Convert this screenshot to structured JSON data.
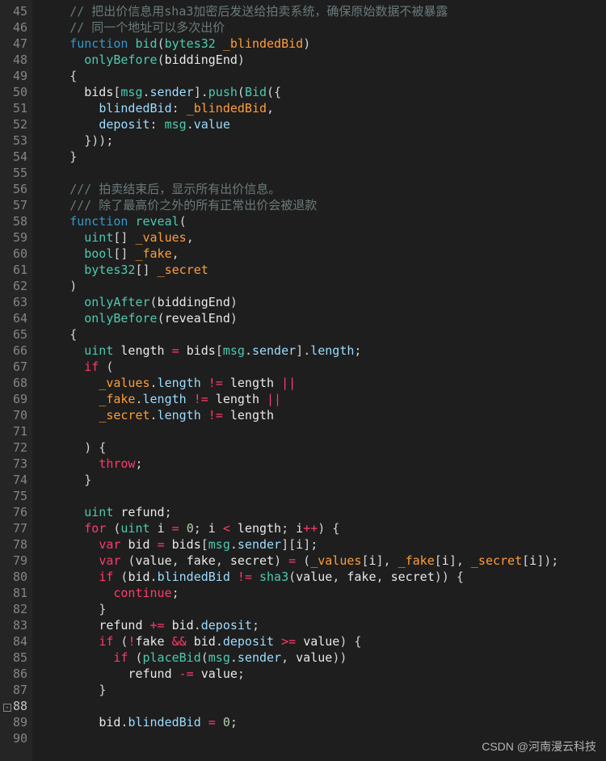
{
  "startLine": 45,
  "endLine": 90,
  "cursorLine": 88,
  "watermark": "CSDN @河南漫云科技",
  "lines": [
    {
      "n": 45,
      "tokens": [
        [
          "    ",
          ""
        ],
        [
          "// 把出价信息用sha3加密后发送给拍卖系统，确保原始数据不被暴露",
          "c-comment"
        ]
      ]
    },
    {
      "n": 46,
      "tokens": [
        [
          "    ",
          ""
        ],
        [
          "// 同一个地址可以多次出价",
          "c-comment"
        ]
      ]
    },
    {
      "n": 47,
      "tokens": [
        [
          "    ",
          ""
        ],
        [
          "function",
          "c-keyword"
        ],
        [
          " ",
          ""
        ],
        [
          "bid",
          "c-funcname"
        ],
        [
          "(",
          "c-punc"
        ],
        [
          "bytes32",
          "c-type"
        ],
        [
          " ",
          ""
        ],
        [
          "_blindedBid",
          "c-param"
        ],
        [
          ")",
          "c-punc"
        ]
      ]
    },
    {
      "n": 48,
      "tokens": [
        [
          "      ",
          ""
        ],
        [
          "onlyBefore",
          "c-funcname"
        ],
        [
          "(",
          "c-punc"
        ],
        [
          "biddingEnd",
          "c-var"
        ],
        [
          ")",
          "c-punc"
        ]
      ]
    },
    {
      "n": 49,
      "tokens": [
        [
          "    ",
          ""
        ],
        [
          "{",
          "c-punc"
        ]
      ]
    },
    {
      "n": 50,
      "tokens": [
        [
          "      ",
          ""
        ],
        [
          "bids",
          "c-var"
        ],
        [
          "[",
          "c-punc"
        ],
        [
          "msg",
          "c-msg"
        ],
        [
          ".",
          "c-punc"
        ],
        [
          "sender",
          "c-prop"
        ],
        [
          "]",
          "c-punc"
        ],
        [
          ".",
          "c-punc"
        ],
        [
          "push",
          "c-funcname"
        ],
        [
          "(",
          "c-punc"
        ],
        [
          "Bid",
          "c-type"
        ],
        [
          "({",
          "c-punc"
        ]
      ]
    },
    {
      "n": 51,
      "tokens": [
        [
          "        ",
          ""
        ],
        [
          "blindedBid",
          "c-prop"
        ],
        [
          ": ",
          "c-punc"
        ],
        [
          "_blindedBid",
          "c-param"
        ],
        [
          ",",
          "c-punc"
        ]
      ]
    },
    {
      "n": 52,
      "tokens": [
        [
          "        ",
          ""
        ],
        [
          "deposit",
          "c-prop"
        ],
        [
          ": ",
          "c-punc"
        ],
        [
          "msg",
          "c-msg"
        ],
        [
          ".",
          "c-punc"
        ],
        [
          "value",
          "c-prop"
        ]
      ]
    },
    {
      "n": 53,
      "tokens": [
        [
          "      ",
          ""
        ],
        [
          "}));",
          "c-punc"
        ]
      ]
    },
    {
      "n": 54,
      "tokens": [
        [
          "    ",
          ""
        ],
        [
          "}",
          "c-punc"
        ]
      ]
    },
    {
      "n": 55,
      "tokens": [
        [
          "",
          ""
        ]
      ]
    },
    {
      "n": 56,
      "tokens": [
        [
          "    ",
          ""
        ],
        [
          "/// 拍卖结束后，显示所有出价信息。",
          "c-comment"
        ]
      ]
    },
    {
      "n": 57,
      "tokens": [
        [
          "    ",
          ""
        ],
        [
          "/// 除了最高价之外的所有正常出价会被退款",
          "c-comment"
        ]
      ]
    },
    {
      "n": 58,
      "tokens": [
        [
          "    ",
          ""
        ],
        [
          "function",
          "c-keyword"
        ],
        [
          " ",
          ""
        ],
        [
          "reveal",
          "c-funcname"
        ],
        [
          "(",
          "c-punc"
        ]
      ]
    },
    {
      "n": 59,
      "tokens": [
        [
          "      ",
          ""
        ],
        [
          "uint",
          "c-type"
        ],
        [
          "[]",
          "c-punc"
        ],
        [
          " ",
          ""
        ],
        [
          "_values",
          "c-param"
        ],
        [
          ",",
          "c-punc"
        ]
      ]
    },
    {
      "n": 60,
      "tokens": [
        [
          "      ",
          ""
        ],
        [
          "bool",
          "c-type"
        ],
        [
          "[]",
          "c-punc"
        ],
        [
          " ",
          ""
        ],
        [
          "_fake",
          "c-param"
        ],
        [
          ",",
          "c-punc"
        ]
      ]
    },
    {
      "n": 61,
      "tokens": [
        [
          "      ",
          ""
        ],
        [
          "bytes32",
          "c-type"
        ],
        [
          "[]",
          "c-punc"
        ],
        [
          " ",
          ""
        ],
        [
          "_secret",
          "c-param"
        ]
      ]
    },
    {
      "n": 62,
      "tokens": [
        [
          "    ",
          ""
        ],
        [
          ")",
          "c-punc"
        ]
      ]
    },
    {
      "n": 63,
      "tokens": [
        [
          "      ",
          ""
        ],
        [
          "onlyAfter",
          "c-funcname"
        ],
        [
          "(",
          "c-punc"
        ],
        [
          "biddingEnd",
          "c-var"
        ],
        [
          ")",
          "c-punc"
        ]
      ]
    },
    {
      "n": 64,
      "tokens": [
        [
          "      ",
          ""
        ],
        [
          "onlyBefore",
          "c-funcname"
        ],
        [
          "(",
          "c-punc"
        ],
        [
          "revealEnd",
          "c-var"
        ],
        [
          ")",
          "c-punc"
        ]
      ]
    },
    {
      "n": 65,
      "tokens": [
        [
          "    ",
          ""
        ],
        [
          "{",
          "c-punc"
        ]
      ]
    },
    {
      "n": 66,
      "tokens": [
        [
          "      ",
          ""
        ],
        [
          "uint",
          "c-type"
        ],
        [
          " ",
          ""
        ],
        [
          "length",
          "c-var"
        ],
        [
          " ",
          ""
        ],
        [
          "=",
          "c-op"
        ],
        [
          " ",
          ""
        ],
        [
          "bids",
          "c-var"
        ],
        [
          "[",
          "c-punc"
        ],
        [
          "msg",
          "c-msg"
        ],
        [
          ".",
          "c-punc"
        ],
        [
          "sender",
          "c-prop"
        ],
        [
          "]",
          "c-punc"
        ],
        [
          ".",
          "c-punc"
        ],
        [
          "length",
          "c-prop"
        ],
        [
          ";",
          "c-punc"
        ]
      ]
    },
    {
      "n": 67,
      "tokens": [
        [
          "      ",
          ""
        ],
        [
          "if",
          "c-control"
        ],
        [
          " (",
          "c-punc"
        ]
      ]
    },
    {
      "n": 68,
      "tokens": [
        [
          "        ",
          ""
        ],
        [
          "_values",
          "c-param"
        ],
        [
          ".",
          "c-punc"
        ],
        [
          "length",
          "c-prop"
        ],
        [
          " ",
          ""
        ],
        [
          "!=",
          "c-op"
        ],
        [
          " ",
          ""
        ],
        [
          "length",
          "c-var"
        ],
        [
          " ",
          ""
        ],
        [
          "||",
          "c-op"
        ]
      ]
    },
    {
      "n": 69,
      "tokens": [
        [
          "        ",
          ""
        ],
        [
          "_fake",
          "c-param"
        ],
        [
          ".",
          "c-punc"
        ],
        [
          "length",
          "c-prop"
        ],
        [
          " ",
          ""
        ],
        [
          "!=",
          "c-op"
        ],
        [
          " ",
          ""
        ],
        [
          "length",
          "c-var"
        ],
        [
          " ",
          ""
        ],
        [
          "||",
          "c-op"
        ]
      ]
    },
    {
      "n": 70,
      "tokens": [
        [
          "        ",
          ""
        ],
        [
          "_secret",
          "c-param"
        ],
        [
          ".",
          "c-punc"
        ],
        [
          "length",
          "c-prop"
        ],
        [
          " ",
          ""
        ],
        [
          "!=",
          "c-op"
        ],
        [
          " ",
          ""
        ],
        [
          "length",
          "c-var"
        ]
      ]
    },
    {
      "n": 71,
      "tokens": [
        [
          "",
          ""
        ]
      ]
    },
    {
      "n": 72,
      "tokens": [
        [
          "      ",
          ""
        ],
        [
          ") {",
          "c-punc"
        ]
      ]
    },
    {
      "n": 73,
      "tokens": [
        [
          "        ",
          ""
        ],
        [
          "throw",
          "c-control"
        ],
        [
          ";",
          "c-punc"
        ]
      ]
    },
    {
      "n": 74,
      "tokens": [
        [
          "      ",
          ""
        ],
        [
          "}",
          "c-punc"
        ]
      ]
    },
    {
      "n": 75,
      "tokens": [
        [
          "",
          ""
        ]
      ]
    },
    {
      "n": 76,
      "tokens": [
        [
          "      ",
          ""
        ],
        [
          "uint",
          "c-type"
        ],
        [
          " ",
          ""
        ],
        [
          "refund",
          "c-var"
        ],
        [
          ";",
          "c-punc"
        ]
      ]
    },
    {
      "n": 77,
      "tokens": [
        [
          "      ",
          ""
        ],
        [
          "for",
          "c-control"
        ],
        [
          " (",
          "c-punc"
        ],
        [
          "uint",
          "c-type"
        ],
        [
          " ",
          ""
        ],
        [
          "i",
          "c-var"
        ],
        [
          " ",
          ""
        ],
        [
          "=",
          "c-op"
        ],
        [
          " ",
          ""
        ],
        [
          "0",
          "c-num"
        ],
        [
          "; ",
          "c-punc"
        ],
        [
          "i",
          "c-var"
        ],
        [
          " ",
          ""
        ],
        [
          "<",
          "c-op"
        ],
        [
          " ",
          ""
        ],
        [
          "length",
          "c-var"
        ],
        [
          "; ",
          "c-punc"
        ],
        [
          "i",
          "c-var"
        ],
        [
          "++",
          "c-op"
        ],
        [
          ") {",
          "c-punc"
        ]
      ]
    },
    {
      "n": 78,
      "tokens": [
        [
          "        ",
          ""
        ],
        [
          "var",
          "c-control"
        ],
        [
          " ",
          ""
        ],
        [
          "bid",
          "c-var"
        ],
        [
          " ",
          ""
        ],
        [
          "=",
          "c-op"
        ],
        [
          " ",
          ""
        ],
        [
          "bids",
          "c-var"
        ],
        [
          "[",
          "c-punc"
        ],
        [
          "msg",
          "c-msg"
        ],
        [
          ".",
          "c-punc"
        ],
        [
          "sender",
          "c-prop"
        ],
        [
          "][",
          "c-punc"
        ],
        [
          "i",
          "c-var"
        ],
        [
          "];",
          "c-punc"
        ]
      ]
    },
    {
      "n": 79,
      "tokens": [
        [
          "        ",
          ""
        ],
        [
          "var",
          "c-control"
        ],
        [
          " (",
          "c-punc"
        ],
        [
          "value",
          "c-var"
        ],
        [
          ", ",
          "c-punc"
        ],
        [
          "fake",
          "c-var"
        ],
        [
          ", ",
          "c-punc"
        ],
        [
          "secret",
          "c-var"
        ],
        [
          ") ",
          "c-punc"
        ],
        [
          "=",
          "c-op"
        ],
        [
          " (",
          "c-punc"
        ],
        [
          "_values",
          "c-param"
        ],
        [
          "[",
          "c-punc"
        ],
        [
          "i",
          "c-var"
        ],
        [
          "], ",
          "c-punc"
        ],
        [
          "_fake",
          "c-param"
        ],
        [
          "[",
          "c-punc"
        ],
        [
          "i",
          "c-var"
        ],
        [
          "], ",
          "c-punc"
        ],
        [
          "_secret",
          "c-param"
        ],
        [
          "[",
          "c-punc"
        ],
        [
          "i",
          "c-var"
        ],
        [
          "]);",
          "c-punc"
        ]
      ]
    },
    {
      "n": 80,
      "tokens": [
        [
          "        ",
          ""
        ],
        [
          "if",
          "c-control"
        ],
        [
          " (",
          "c-punc"
        ],
        [
          "bid",
          "c-var"
        ],
        [
          ".",
          "c-punc"
        ],
        [
          "blindedBid",
          "c-prop"
        ],
        [
          " ",
          ""
        ],
        [
          "!=",
          "c-op"
        ],
        [
          " ",
          ""
        ],
        [
          "sha3",
          "c-funcname"
        ],
        [
          "(",
          "c-punc"
        ],
        [
          "value",
          "c-var"
        ],
        [
          ", ",
          "c-punc"
        ],
        [
          "fake",
          "c-var"
        ],
        [
          ", ",
          "c-punc"
        ],
        [
          "secret",
          "c-var"
        ],
        [
          ")) {",
          "c-punc"
        ]
      ]
    },
    {
      "n": 81,
      "tokens": [
        [
          "          ",
          ""
        ],
        [
          "continue",
          "c-control"
        ],
        [
          ";",
          "c-punc"
        ]
      ]
    },
    {
      "n": 82,
      "tokens": [
        [
          "        ",
          ""
        ],
        [
          "}",
          "c-punc"
        ]
      ]
    },
    {
      "n": 83,
      "tokens": [
        [
          "        ",
          ""
        ],
        [
          "refund",
          "c-var"
        ],
        [
          " ",
          ""
        ],
        [
          "+=",
          "c-op"
        ],
        [
          " ",
          ""
        ],
        [
          "bid",
          "c-var"
        ],
        [
          ".",
          "c-punc"
        ],
        [
          "deposit",
          "c-prop"
        ],
        [
          ";",
          "c-punc"
        ]
      ]
    },
    {
      "n": 84,
      "tokens": [
        [
          "        ",
          ""
        ],
        [
          "if",
          "c-control"
        ],
        [
          " (",
          "c-punc"
        ],
        [
          "!",
          "c-op"
        ],
        [
          "fake",
          "c-var"
        ],
        [
          " ",
          ""
        ],
        [
          "&&",
          "c-op"
        ],
        [
          " ",
          ""
        ],
        [
          "bid",
          "c-var"
        ],
        [
          ".",
          "c-punc"
        ],
        [
          "deposit",
          "c-prop"
        ],
        [
          " ",
          ""
        ],
        [
          ">=",
          "c-op"
        ],
        [
          " ",
          ""
        ],
        [
          "value",
          "c-var"
        ],
        [
          ") {",
          "c-punc"
        ]
      ]
    },
    {
      "n": 85,
      "tokens": [
        [
          "          ",
          ""
        ],
        [
          "if",
          "c-control"
        ],
        [
          " (",
          "c-punc"
        ],
        [
          "placeBid",
          "c-funcname"
        ],
        [
          "(",
          "c-punc"
        ],
        [
          "msg",
          "c-msg"
        ],
        [
          ".",
          "c-punc"
        ],
        [
          "sender",
          "c-prop"
        ],
        [
          ", ",
          "c-punc"
        ],
        [
          "value",
          "c-var"
        ],
        [
          "))",
          "c-punc"
        ]
      ]
    },
    {
      "n": 86,
      "tokens": [
        [
          "            ",
          ""
        ],
        [
          "refund",
          "c-var"
        ],
        [
          " ",
          ""
        ],
        [
          "-=",
          "c-op"
        ],
        [
          " ",
          ""
        ],
        [
          "value",
          "c-var"
        ],
        [
          ";",
          "c-punc"
        ]
      ]
    },
    {
      "n": 87,
      "tokens": [
        [
          "        ",
          ""
        ],
        [
          "}",
          "c-punc"
        ]
      ]
    },
    {
      "n": 88,
      "tokens": [
        [
          "",
          ""
        ]
      ]
    },
    {
      "n": 89,
      "tokens": [
        [
          "        ",
          ""
        ],
        [
          "bid",
          "c-var"
        ],
        [
          ".",
          "c-punc"
        ],
        [
          "blindedBid",
          "c-prop"
        ],
        [
          " ",
          ""
        ],
        [
          "=",
          "c-op"
        ],
        [
          " ",
          ""
        ],
        [
          "0",
          "c-num"
        ],
        [
          ";",
          "c-punc"
        ]
      ]
    },
    {
      "n": 90,
      "tokens": [
        [
          "",
          ""
        ]
      ]
    }
  ]
}
